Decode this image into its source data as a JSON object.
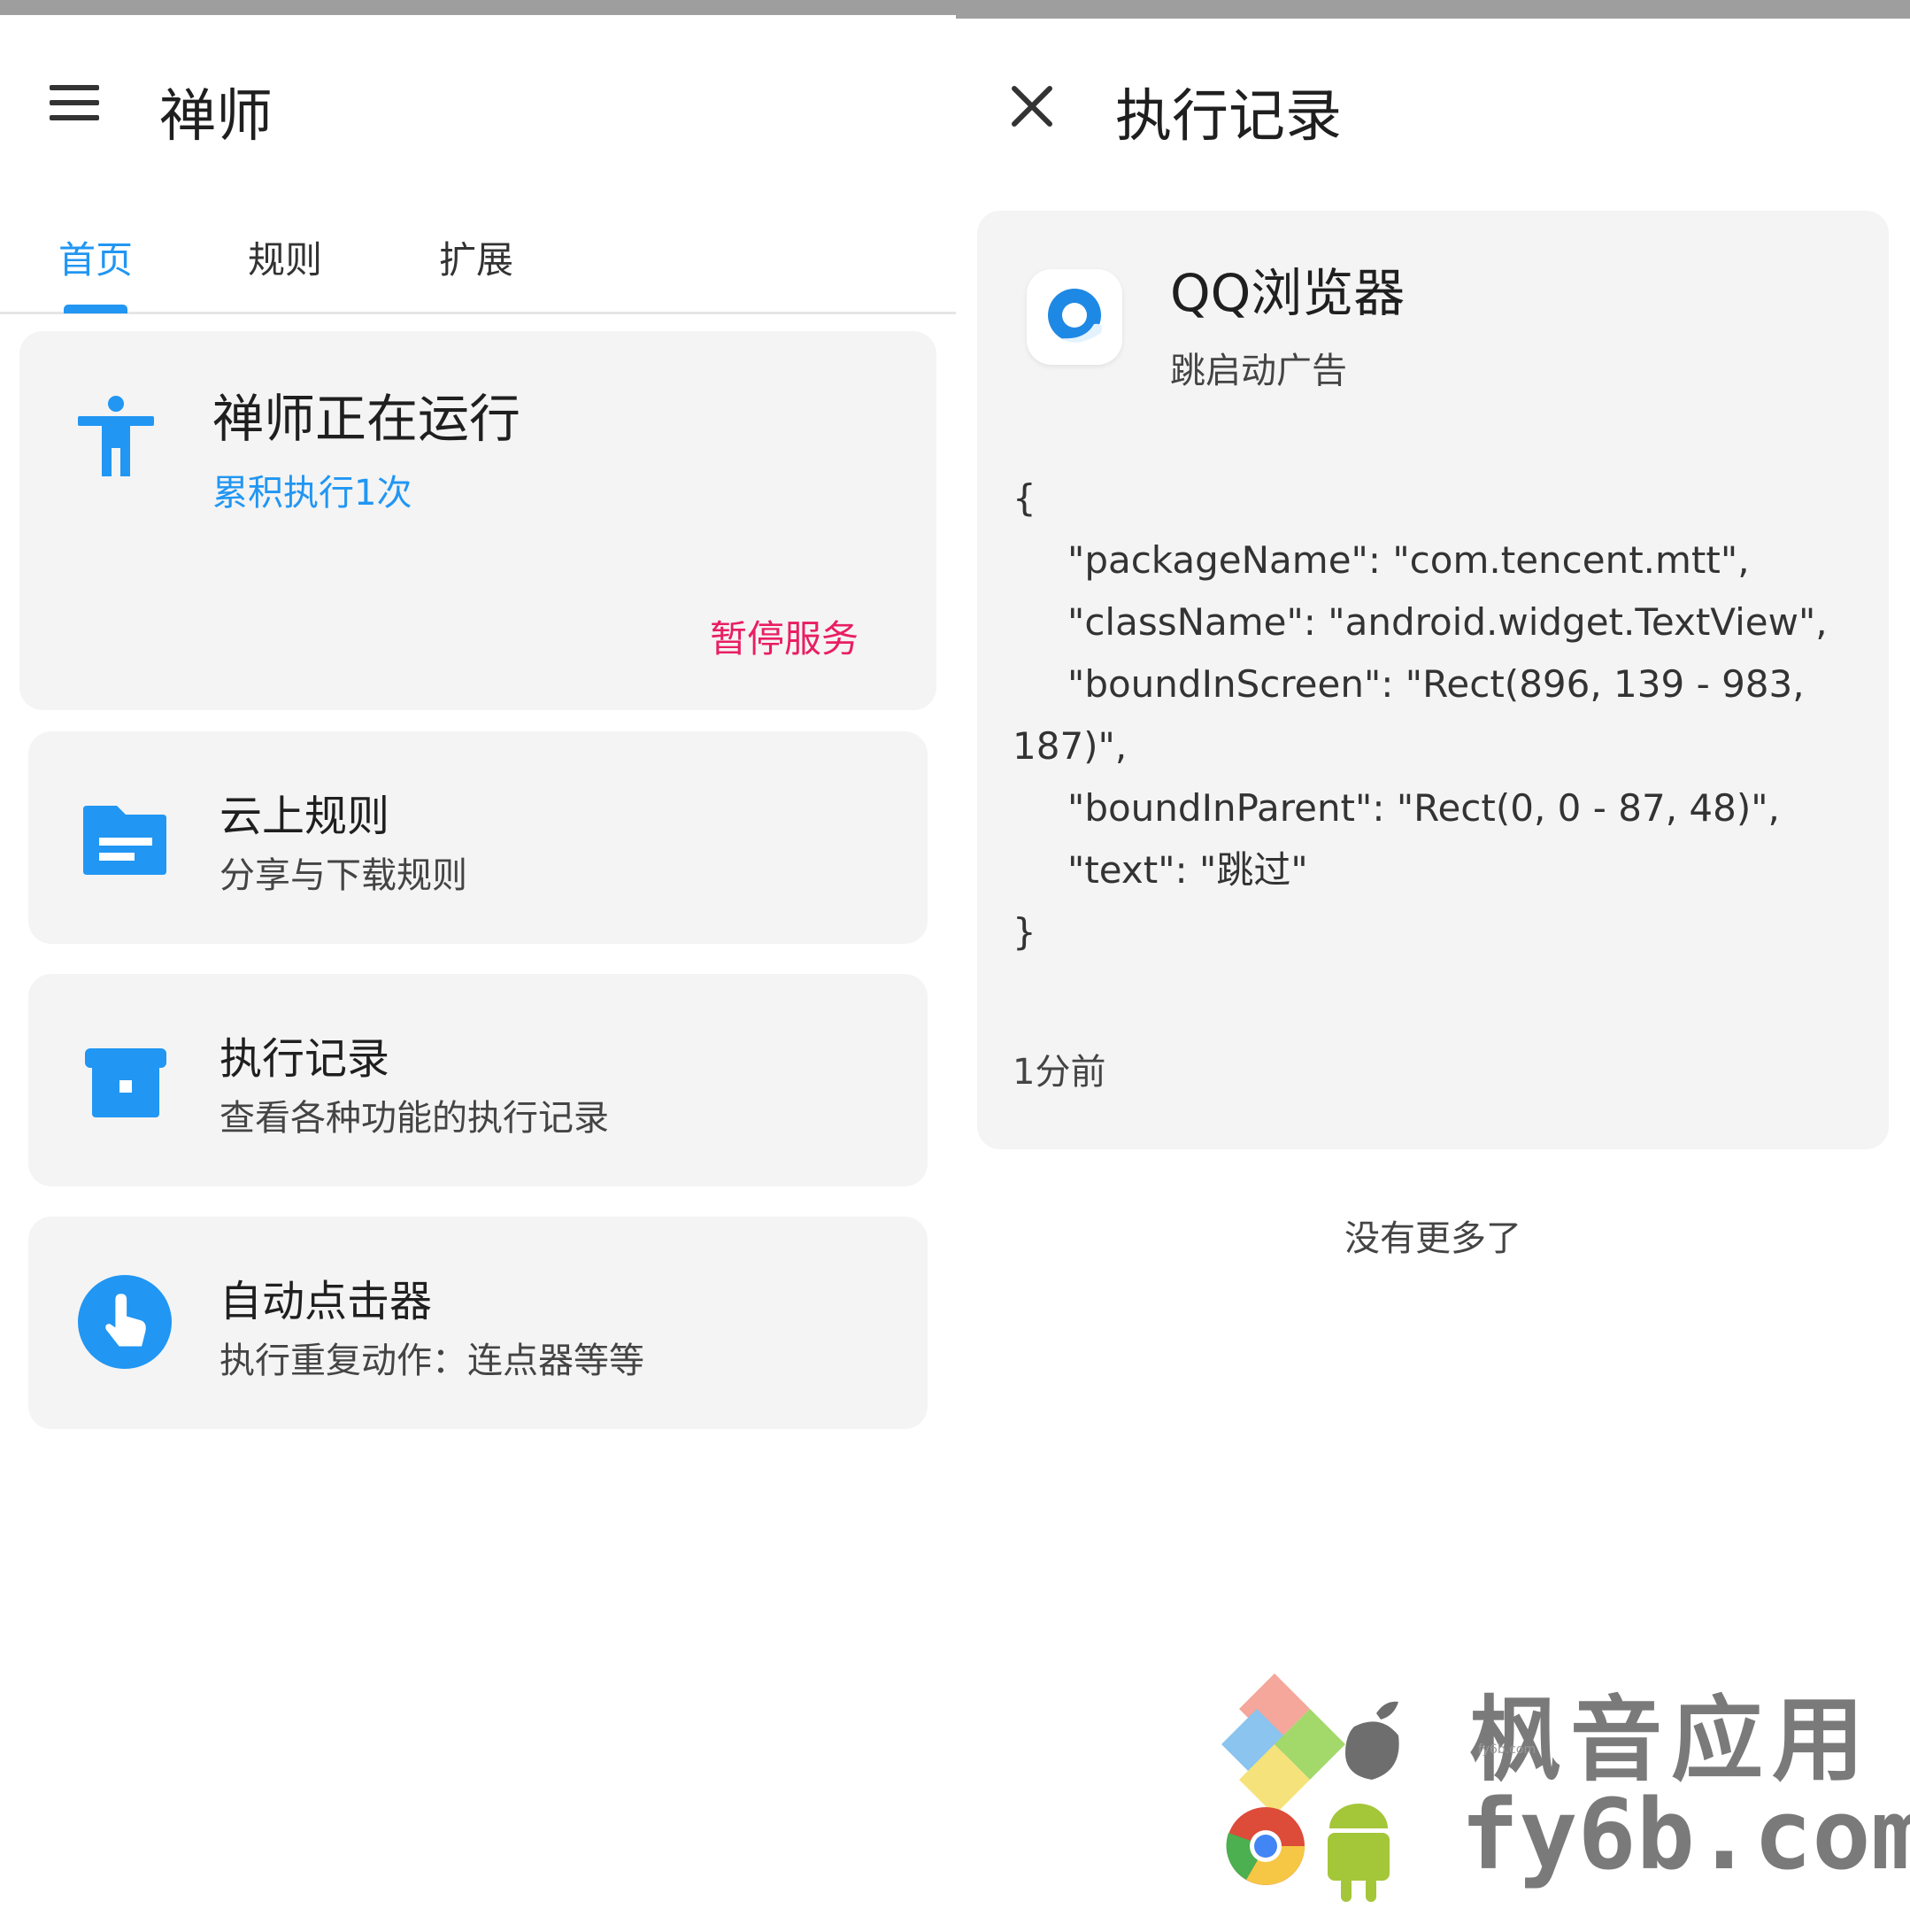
{
  "left": {
    "app_title": "禅师",
    "tabs": [
      {
        "label": "首页",
        "active": true
      },
      {
        "label": "规则",
        "active": false
      },
      {
        "label": "扩展",
        "active": false
      }
    ],
    "status": {
      "title": "禅师正在运行",
      "count": "累积执行1次",
      "pause_label": "暂停服务"
    },
    "menu": [
      {
        "title": "云上规则",
        "subtitle": "分享与下载规则",
        "icon": "folder-icon"
      },
      {
        "title": "执行记录",
        "subtitle": "查看各种功能的执行记录",
        "icon": "archive-icon"
      },
      {
        "title": "自动点击器",
        "subtitle": "执行重复动作：连点器等等",
        "icon": "touch-icon"
      }
    ]
  },
  "right": {
    "page_title": "执行记录",
    "record": {
      "app_name": "QQ浏览器",
      "action": "跳启动广告",
      "code_lines": [
        "{",
        "\"packageName\": \"com.tencent.mtt\",",
        "\"className\": \"android.widget.TextView\",",
        "\"boundInScreen\": \"Rect(896, 139 - 983,",
        "187)\",",
        "\"boundInParent\": \"Rect(0, 0 - 87, 48)\",",
        "\"text\": \"跳过\"",
        "}"
      ],
      "time": "1分前"
    },
    "no_more": "没有更多了"
  },
  "watermark": {
    "name": "枫音应用",
    "domain": "fy6b.com",
    "small": "fy6b.com"
  },
  "colors": {
    "accent": "#2196f3",
    "danger": "#e91e63",
    "card_bg": "#f4f4f4",
    "status_bar": "#9e9e9e"
  }
}
